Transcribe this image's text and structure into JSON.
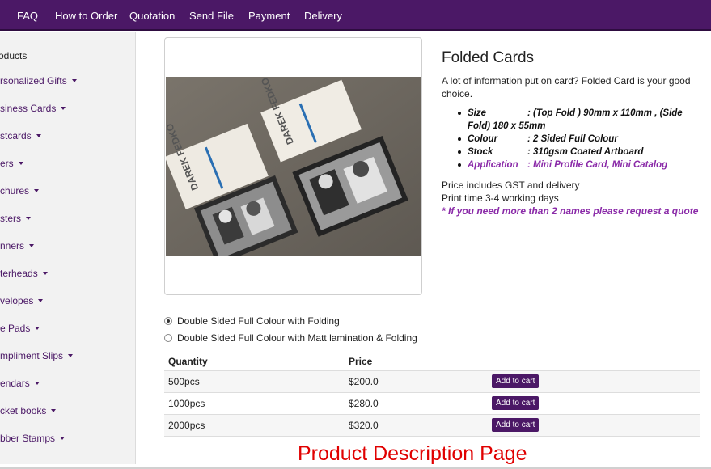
{
  "nav": {
    "items": [
      "FAQ",
      "How to Order",
      "Quotation",
      "Send File",
      "Payment",
      "Delivery"
    ]
  },
  "sidebar": {
    "title": "roducts",
    "items": [
      "rsonalized Gifts",
      "siness Cards",
      "stcards",
      "ers",
      "chures",
      "sters",
      "nners",
      "terheads",
      "velopes",
      "e Pads",
      "mpliment Slips",
      "endars",
      "cket books",
      "bber Stamps"
    ]
  },
  "product": {
    "title": "Folded Cards",
    "description": "A lot of information put on card? Folded Card is your good choice.",
    "specs": [
      {
        "key": "Size",
        "value": ": (Top Fold ) 90mm x 110mm , (Side Fold) 180 x 55mm"
      },
      {
        "key": "Colour",
        "value": ": 2 Sided Full Colour"
      },
      {
        "key": "Stock",
        "value": ": 310gsm Coated Artboard"
      },
      {
        "key": "Application",
        "value": ": Mini Profile Card, Mini Catalog"
      }
    ],
    "price_note": "Price includes GST and delivery",
    "print_time": "Print time 3-4 working days",
    "names_note": "* If you need more than 2 names please request a quote",
    "card_text": "DAREK FEDKO"
  },
  "options": [
    {
      "label": "Double Sided Full Colour with Folding",
      "selected": true
    },
    {
      "label": "Double Sided Full Colour with Matt lamination & Folding",
      "selected": false
    }
  ],
  "table": {
    "headers": {
      "quantity": "Quantity",
      "price": "Price"
    },
    "rows": [
      {
        "quantity": "500pcs",
        "price": "$200.0",
        "button": "Add to cart"
      },
      {
        "quantity": "1000pcs",
        "price": "$280.0",
        "button": "Add to cart"
      },
      {
        "quantity": "2000pcs",
        "price": "$320.0",
        "button": "Add to cart"
      }
    ]
  },
  "caption": "Product Description Page",
  "colors": {
    "brand": "#4b1866",
    "accent_text": "#8a2aa8",
    "caption": "#e00000"
  }
}
